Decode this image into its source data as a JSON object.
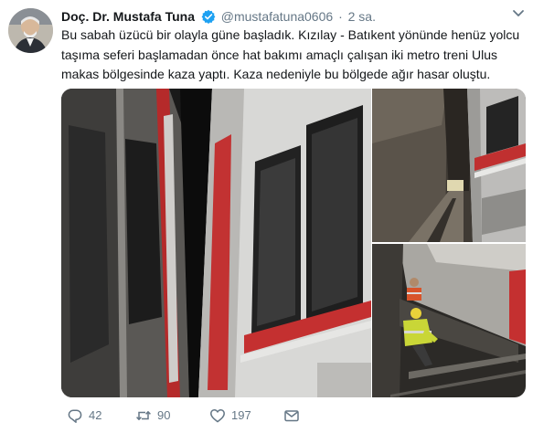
{
  "tweet": {
    "author_name": "Doç. Dr. Mustafa Tuna",
    "handle": "@mustafatuna0606",
    "separator": "·",
    "time": "2 sa.",
    "text": "Bu sabah üzücü bir olayla güne başladık. Kızılay - Batıkent yönünde henüz yolcu taşıma seferi başlamadan önce hat bakımı amaçlı çalışan iki metro treni Ulus makas bölgesinde kaza yaptı. Kaza nedeniyle bu bölgede ağır hasar oluştu."
  },
  "icons": {
    "verified": "verified-badge-icon",
    "caret": "chevron-down-icon",
    "reply": "reply-icon",
    "retweet": "retweet-icon",
    "like": "heart-icon",
    "message": "envelope-icon"
  },
  "actions": {
    "reply_count": "42",
    "retweet_count": "90",
    "like_count": "197"
  },
  "colors": {
    "text": "#14171a",
    "secondary": "#657786",
    "verified": "#1da1f2"
  }
}
